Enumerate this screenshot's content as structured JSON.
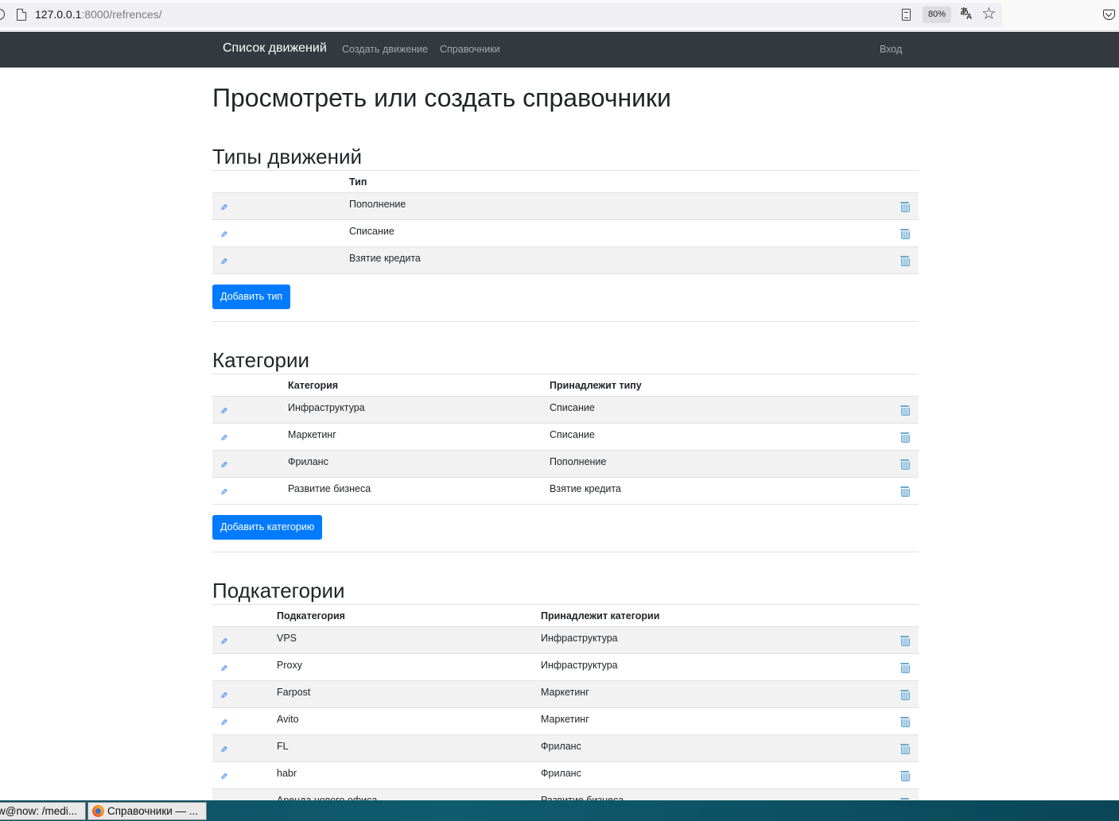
{
  "browser": {
    "url_host": "127.0.0.1",
    "url_rest": ":8000/refrences/",
    "zoom": "80%"
  },
  "navbar": {
    "brand": "Список движений",
    "create_link": "Создать движение",
    "refs_link": "Справочники",
    "login_link": "Вход"
  },
  "page": {
    "title": "Просмотреть или создать справочники"
  },
  "types": {
    "heading": "Типы движений",
    "col_type": "Тип",
    "rows": [
      "Пополнение",
      "Списание",
      "Взятие кредита"
    ],
    "add_button": "Добавить тип"
  },
  "categories": {
    "heading": "Категории",
    "col_category": "Категория",
    "col_type": "Принадлежит типу",
    "rows": [
      {
        "name": "Инфраструктура",
        "type": "Списание"
      },
      {
        "name": "Маркетинг",
        "type": "Списание"
      },
      {
        "name": "Фриланс",
        "type": "Пополнение"
      },
      {
        "name": "Развитие бизнеса",
        "type": "Взятие кредита"
      }
    ],
    "add_button": "Добавить категорию"
  },
  "subcategories": {
    "heading": "Подкатегории",
    "col_sub": "Подкатегория",
    "col_cat": "Принадлежит категории",
    "rows": [
      {
        "name": "VPS",
        "category": "Инфраструктура"
      },
      {
        "name": "Proxy",
        "category": "Инфраструктура"
      },
      {
        "name": "Farpost",
        "category": "Маркетинг"
      },
      {
        "name": "Avito",
        "category": "Маркетинг"
      },
      {
        "name": "FL",
        "category": "Фриланс"
      },
      {
        "name": "habr",
        "category": "Фриланс"
      },
      {
        "name": "Аренда нового офиса",
        "category": "Развитие бизнеса"
      }
    ]
  },
  "taskbar": {
    "terminal": "w@now: /medi...",
    "firefox": "Справочники — ..."
  },
  "icons": {
    "edit": "pencil-icon",
    "delete": "trash-icon"
  }
}
